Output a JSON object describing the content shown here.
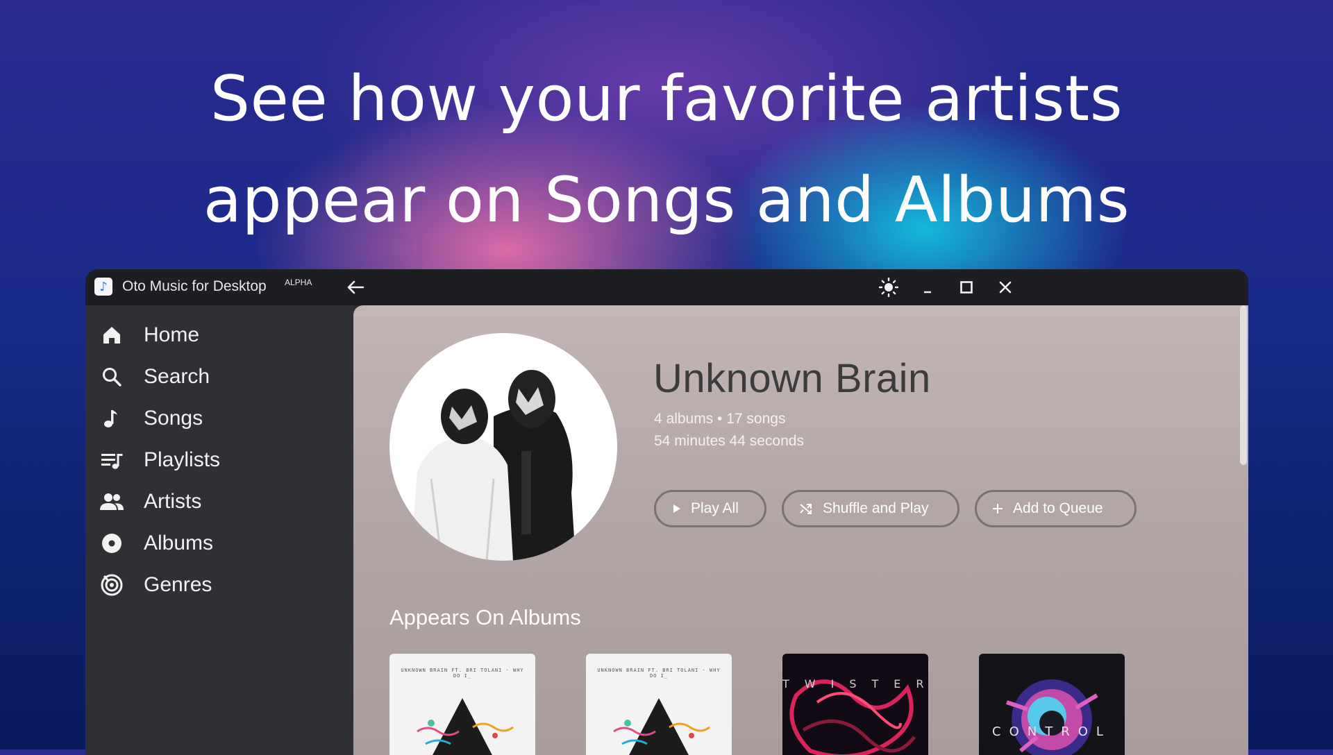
{
  "headline": {
    "line1": "See how your favorite artists",
    "line2": "appear on Songs and Albums"
  },
  "window": {
    "app_title": "Oto Music for Desktop",
    "app_badge": "ALPHA",
    "icons": {
      "app": "music-note-icon",
      "back": "arrow-left-icon",
      "theme": "sun-icon",
      "minimize": "minimize-icon",
      "maximize": "maximize-icon",
      "close": "close-icon"
    }
  },
  "sidebar": {
    "items": [
      {
        "label": "Home",
        "icon": "home-icon"
      },
      {
        "label": "Search",
        "icon": "search-icon"
      },
      {
        "label": "Songs",
        "icon": "music-note-icon"
      },
      {
        "label": "Playlists",
        "icon": "playlist-icon"
      },
      {
        "label": "Artists",
        "icon": "people-icon"
      },
      {
        "label": "Albums",
        "icon": "album-icon"
      },
      {
        "label": "Genres",
        "icon": "genre-icon"
      }
    ]
  },
  "artist": {
    "name": "Unknown Brain",
    "stats": "4 albums • 17 songs",
    "duration": "54 minutes 44 seconds",
    "actions": {
      "play_all": "Play All",
      "shuffle": "Shuffle and Play",
      "queue": "Add to Queue"
    }
  },
  "appears_on": {
    "title": "Appears On Albums",
    "albums": [
      {
        "cover_text": "UNKNOWN BRAIN FT. BRI TOLANI · WHY DO I_",
        "style": "light"
      },
      {
        "cover_text": "UNKNOWN BRAIN FT. BRI TOLANI · WHY DO I_",
        "style": "light"
      },
      {
        "cover_text": "TWISTER",
        "style": "dark-red"
      },
      {
        "cover_text": "CONTROL",
        "style": "dark-blue"
      }
    ]
  },
  "colors": {
    "titlebar": "#1d1e21",
    "sidebar": "#2f3034",
    "accent_text": "#ffffff",
    "pill_border": "#7b7171"
  }
}
